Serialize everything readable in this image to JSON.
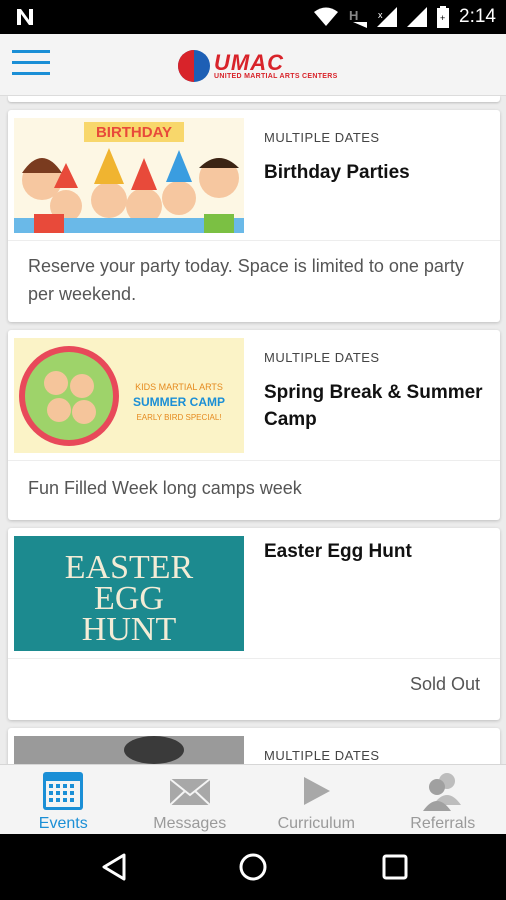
{
  "status_bar": {
    "time": "2:14",
    "icons": [
      "n-notification-icon",
      "wifi-icon",
      "h-network-icon",
      "signal-icon",
      "signal-2-icon",
      "battery-icon"
    ]
  },
  "header": {
    "logo_text": "UMAC",
    "logo_subtext": "UNITED MARTIAL ARTS CENTERS",
    "brand_colors": {
      "red": "#d8232a",
      "blue": "#1d5fb5",
      "accent": "#1b8fd6"
    }
  },
  "events": [
    {
      "dates": "MULTIPLE DATES",
      "title": "Birthday Parties",
      "description": "Reserve your party today. Space is limited to one party per weekend.",
      "image_text": "BIRTHDAY"
    },
    {
      "dates": "MULTIPLE DATES",
      "title": "Spring Break & Summer Camp",
      "description": "Fun Filled Week long camps week",
      "image_text_1": "KIDS MARTIAL ARTS",
      "image_text_2": "SUMMER CAMP",
      "image_text_3": "EARLY BIRD SPECIAL!"
    },
    {
      "title": "Easter Egg Hunt",
      "status": "Sold Out",
      "image_text_1": "EASTER",
      "image_text_2": "EGG",
      "image_text_3": "HUNT"
    },
    {
      "dates": "MULTIPLE DATES"
    }
  ],
  "bottom_nav": [
    {
      "label": "Events",
      "icon": "calendar-icon",
      "active": true
    },
    {
      "label": "Messages",
      "icon": "envelope-icon",
      "active": false
    },
    {
      "label": "Curriculum",
      "icon": "play-icon",
      "active": false
    },
    {
      "label": "Referrals",
      "icon": "people-icon",
      "active": false
    }
  ]
}
